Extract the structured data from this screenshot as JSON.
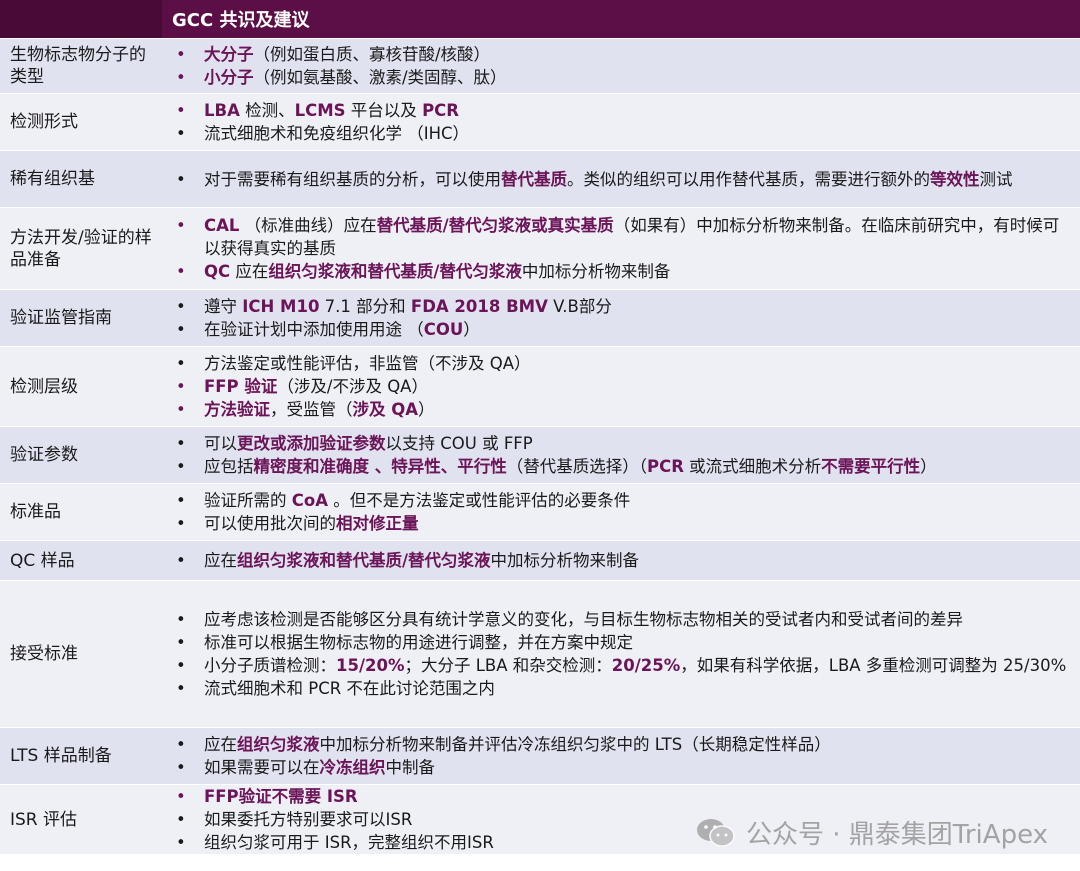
{
  "header": {
    "left": "",
    "title": "GCC 共识及建议"
  },
  "rows": [
    {
      "label": "生物标志物分子的类型",
      "items": [
        {
          "hl": true,
          "parts": [
            {
              "t": "大分子",
              "em": true
            },
            {
              "t": "（例如蛋白质、寡核苷酸/核酸）"
            }
          ]
        },
        {
          "hl": true,
          "parts": [
            {
              "t": "小分子",
              "em": true
            },
            {
              "t": "（例如氨基酸、激素/类固醇、肽）"
            }
          ]
        }
      ]
    },
    {
      "label": "检测形式",
      "items": [
        {
          "hl": true,
          "parts": [
            {
              "t": "LBA",
              "em": true
            },
            {
              "t": " 检测、"
            },
            {
              "t": "LCMS",
              "em": true
            },
            {
              "t": " 平台以及 "
            },
            {
              "t": "PCR",
              "em": true
            }
          ]
        },
        {
          "parts": [
            {
              "t": "流式细胞术和免疫组织化学 （IHC）"
            }
          ]
        }
      ]
    },
    {
      "label": "稀有组织基",
      "items": [
        {
          "parts": [
            {
              "t": "对于需要稀有组织基质的分析，可以使用"
            },
            {
              "t": "替代基质",
              "em": true
            },
            {
              "t": "。类似的组织可以用作替代基质，需要进行额外的"
            },
            {
              "t": "等效性",
              "em": true
            },
            {
              "t": "测试"
            }
          ]
        }
      ]
    },
    {
      "label": "方法开发/验证的样品准备",
      "items": [
        {
          "hl": true,
          "parts": [
            {
              "t": "CAL",
              "em": true
            },
            {
              "t": " （标准曲线）应在"
            },
            {
              "t": "替代基质/替代匀浆液或真实基质",
              "em": true
            },
            {
              "t": "（如果有）中加标分析物来制备。在临床前研究中，有时候可以获得真实的基质"
            }
          ]
        },
        {
          "hl": true,
          "parts": [
            {
              "t": "QC",
              "em": true
            },
            {
              "t": " 应在"
            },
            {
              "t": "组织匀浆液和替代基质/替代匀浆液",
              "em": true
            },
            {
              "t": "中加标分析物来制备"
            }
          ]
        }
      ]
    },
    {
      "label": "验证监管指南",
      "items": [
        {
          "parts": [
            {
              "t": "遵守 "
            },
            {
              "t": "ICH M10",
              "em": true
            },
            {
              "t": "  7.1 部分和 "
            },
            {
              "t": "FDA 2018 BMV",
              "em": true
            },
            {
              "t": "  V.B部分"
            }
          ]
        },
        {
          "parts": [
            {
              "t": "在验证计划中添加使用用途 （"
            },
            {
              "t": "COU",
              "em": true
            },
            {
              "t": "）"
            }
          ]
        }
      ]
    },
    {
      "label": "检测层级",
      "items": [
        {
          "parts": [
            {
              "t": "方法鉴定或性能评估，非监管（不涉及 QA）"
            }
          ]
        },
        {
          "hl": true,
          "parts": [
            {
              "t": "FFP 验证",
              "em": true
            },
            {
              "t": "（涉及/不涉及 QA）"
            }
          ]
        },
        {
          "hl": true,
          "parts": [
            {
              "t": "方法验证",
              "em": true
            },
            {
              "t": "，受监管（"
            },
            {
              "t": "涉及 QA",
              "em": true
            },
            {
              "t": "）"
            }
          ]
        }
      ]
    },
    {
      "label": "验证参数",
      "items": [
        {
          "parts": [
            {
              "t": "可以"
            },
            {
              "t": "更改或添加验证参数",
              "em": true
            },
            {
              "t": "以支持 COU 或 FFP"
            }
          ]
        },
        {
          "parts": [
            {
              "t": "应包括"
            },
            {
              "t": "精密度和准确度 、特异性、平行性",
              "em": true
            },
            {
              "t": "（替代基质选择）（"
            },
            {
              "t": "PCR",
              "em": true
            },
            {
              "t": " 或流式细胞术分析"
            },
            {
              "t": "不需要平行性",
              "em": true
            },
            {
              "t": "）"
            }
          ]
        }
      ]
    },
    {
      "label": "标准品",
      "items": [
        {
          "parts": [
            {
              "t": "验证所需的 "
            },
            {
              "t": "CoA",
              "em": true
            },
            {
              "t": " 。但不是方法鉴定或性能评估的必要条件"
            }
          ]
        },
        {
          "parts": [
            {
              "t": "可以使用批次间的"
            },
            {
              "t": "相对修正量",
              "em": true
            }
          ]
        }
      ]
    },
    {
      "label": "QC 样品",
      "items": [
        {
          "parts": [
            {
              "t": "应在"
            },
            {
              "t": "组织匀浆液和替代基质/替代匀浆液",
              "em": true
            },
            {
              "t": "中加标分析物来制备"
            }
          ]
        }
      ]
    },
    {
      "label": "接受标准",
      "items": [
        {
          "parts": [
            {
              "t": "应考虑该检测是否能够区分具有统计学意义的变化，与目标生物标志物相关的受试者内和受试者间的差异"
            }
          ]
        },
        {
          "parts": [
            {
              "t": "标准可以根据生物标志物的用途进行调整，并在方案中规定"
            }
          ]
        },
        {
          "parts": [
            {
              "t": "小分子质谱检测："
            },
            {
              "t": "15/20%",
              "em": true
            },
            {
              "t": "；大分子 LBA 和杂交检测："
            },
            {
              "t": "20/25%",
              "em": true
            },
            {
              "t": "，如果有科学依据，LBA 多重检测可调整为 25/30%"
            }
          ]
        },
        {
          "parts": [
            {
              "t": "流式细胞术和 PCR 不在此讨论范围之内"
            }
          ]
        }
      ]
    },
    {
      "label": "LTS 样品制备",
      "items": [
        {
          "parts": [
            {
              "t": "应在"
            },
            {
              "t": "组织匀浆液",
              "em": true
            },
            {
              "t": "中加标分析物来制备并评估冷冻组织匀浆中的 LTS（长期稳定性样品）"
            }
          ]
        },
        {
          "parts": [
            {
              "t": "如果需要可以在"
            },
            {
              "t": "冷冻组织",
              "em": true
            },
            {
              "t": "中制备"
            }
          ]
        }
      ]
    },
    {
      "label": "ISR 评估",
      "items": [
        {
          "hl": true,
          "parts": [
            {
              "t": "FFP验证不需要 ISR",
              "em": true
            }
          ]
        },
        {
          "parts": [
            {
              "t": "如果委托方特别要求可以ISR"
            }
          ]
        },
        {
          "parts": [
            {
              "t": "组织匀浆可用于 ISR，完整组织不用ISR"
            }
          ]
        }
      ]
    }
  ],
  "watermark": {
    "text": "公众号 · 鼎泰集团TriApex",
    "icon": "wechat-icon"
  },
  "colors": {
    "header": "#5c0f46",
    "accent": "#6b1457",
    "row_odd": "#e0e3ef",
    "row_even": "#eff0f6"
  }
}
